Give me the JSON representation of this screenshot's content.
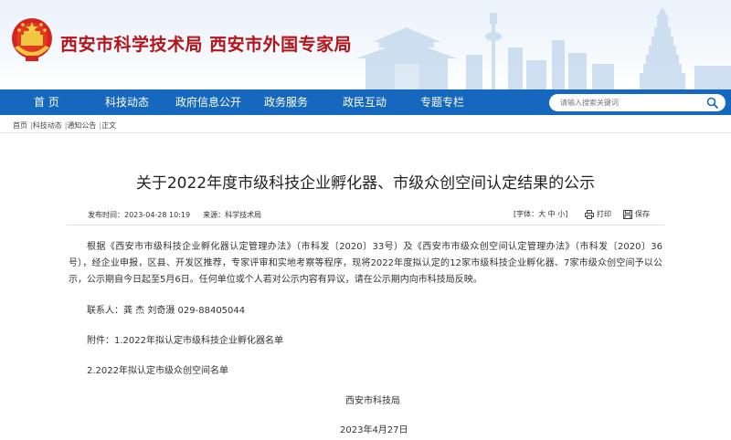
{
  "header": {
    "title": "西安市科学技术局 西安市外国专家局"
  },
  "nav": {
    "items": [
      "首 页",
      "科技动态",
      "政府信息公开",
      "政务服务",
      "政民互动",
      "专题专栏"
    ],
    "search_placeholder": "请输入搜索关键词"
  },
  "breadcrumb": {
    "items": [
      "首页",
      "科技动态",
      "通知公告",
      "正文"
    ]
  },
  "article": {
    "title": "关于2022年度市级科技企业孵化器、市级众创空间认定结果的公示",
    "publish_time": "发布时间：2023-04-28 10:19",
    "source": "来源：科学技术局",
    "font_size_label": "[字体：大 中 小]",
    "print_label": "打印",
    "save_label": "保存",
    "body_lines": [
      "根据《西安市市级科技企业孵化器认定管理办法》（市科发〔2020〕33号）及《西安市市级众创空间认定管理办法》（市科发〔2020〕",
      "36号），经企业申报，区县、开发区推荐，专家评审和实地考察等程序，现将2022年度拟认定的12家市级科技企业孵化器、7家市级众创空",
      "间予以公示，公示期自今日起至5月6日。任何单位或个人若对公示内容有异议，请在公示期内向市科技局反映。"
    ],
    "contact": "联系人：龚 杰 刘奇滠 029-88405044",
    "attachment_1": "附件：1.2022年拟认定市级科技企业孵化器名单",
    "attachment_2": "2.2022年拟认定市级众创空间名单",
    "signature": "西安市科技局",
    "date": "2023年4月27日"
  },
  "colors": {
    "nav_bg": "#1668bf",
    "title_red": "#b3151a"
  }
}
